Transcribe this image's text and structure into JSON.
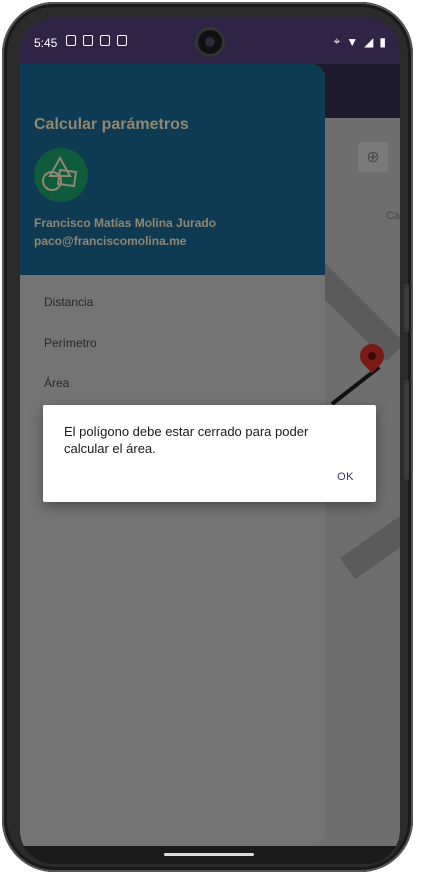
{
  "status_bar": {
    "time": "5:45"
  },
  "map": {
    "label_partial": "Ca"
  },
  "drawer": {
    "title": "Calcular parámetros",
    "user_name": "Francisco Matías Molina Jurado",
    "user_email": "paco@franciscomolina.me",
    "items": [
      {
        "label": "Distancia"
      },
      {
        "label": "Perímetro"
      },
      {
        "label": "Área"
      }
    ]
  },
  "dialog": {
    "message": "El polígono debe estar cerrado para poder calcular el área.",
    "ok_label": "OK"
  },
  "colors": {
    "status_bar": "#2f2346",
    "drawer_header": "#0e3a54",
    "drawer_body": "#747474",
    "header_text": "#8f8770",
    "dialog_accent": "#3a2f6b"
  }
}
